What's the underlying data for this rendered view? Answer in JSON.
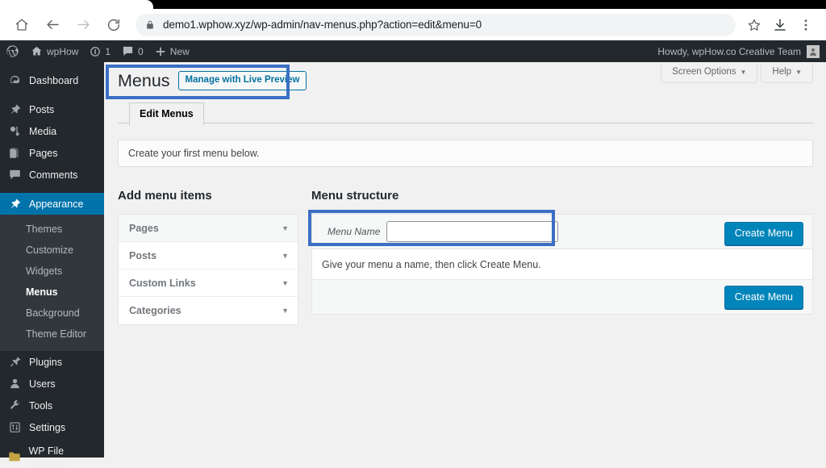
{
  "browser": {
    "url": "demo1.wphow.xyz/wp-admin/nav-menus.php?action=edit&menu=0",
    "icons": {
      "home": "home-icon",
      "back": "back-arrow-icon",
      "forward": "forward-arrow-icon",
      "reload": "reload-icon",
      "lock": "lock-icon",
      "bookmark": "star-icon",
      "download": "download-icon",
      "menu": "three-dots-menu-icon"
    }
  },
  "adminbar": {
    "wp_logo": "wordpress-logo-icon",
    "site_name": "wpHow",
    "updates_count": "1",
    "comments_count": "0",
    "new_label": "New",
    "howdy": "Howdy, wpHow.co Creative Team"
  },
  "sidebar": {
    "items": [
      {
        "label": "Dashboard",
        "icon": "dashboard-icon"
      },
      {
        "label": "Posts",
        "icon": "pin-icon"
      },
      {
        "label": "Media",
        "icon": "media-icon"
      },
      {
        "label": "Pages",
        "icon": "pages-icon"
      },
      {
        "label": "Comments",
        "icon": "comment-icon"
      },
      {
        "label": "Appearance",
        "icon": "appearance-brush-icon",
        "current": true
      },
      {
        "label": "Plugins",
        "icon": "plugin-icon"
      },
      {
        "label": "Users",
        "icon": "user-icon"
      },
      {
        "label": "Tools",
        "icon": "wrench-icon"
      },
      {
        "label": "Settings",
        "icon": "settings-sliders-icon"
      },
      {
        "label": "WP File Manager",
        "icon": "folder-icon"
      }
    ],
    "submenu": [
      {
        "label": "Themes"
      },
      {
        "label": "Customize"
      },
      {
        "label": "Widgets"
      },
      {
        "label": "Menus",
        "current": true
      },
      {
        "label": "Background"
      },
      {
        "label": "Theme Editor"
      }
    ]
  },
  "screen_meta": {
    "screen_options": "Screen Options",
    "help": "Help",
    "caret": "▼"
  },
  "page": {
    "title": "Menus",
    "live_preview_button": "Manage with Live Preview",
    "tab": "Edit Menus",
    "notice": "Create your first menu below.",
    "add_items_heading": "Add menu items",
    "structure_heading": "Menu structure"
  },
  "accordion": {
    "panels": [
      {
        "label": "Pages",
        "caret": "▼"
      },
      {
        "label": "Posts",
        "caret": "▼"
      },
      {
        "label": "Custom Links",
        "caret": "▼"
      },
      {
        "label": "Categories",
        "caret": "▼"
      }
    ]
  },
  "menu_structure": {
    "menu_name_label": "Menu Name",
    "menu_name_value": "",
    "menu_name_placeholder": "",
    "create_menu_top": "Create Menu",
    "help_text": "Give your menu a name, then click Create Menu.",
    "create_menu_bottom": "Create Menu"
  },
  "colors": {
    "wp_blue": "#0073aa",
    "button_blue": "#0085ba",
    "sidebar_dark": "#23282d",
    "submenu_dark": "#32373c",
    "highlight": "#3b6fc4"
  }
}
